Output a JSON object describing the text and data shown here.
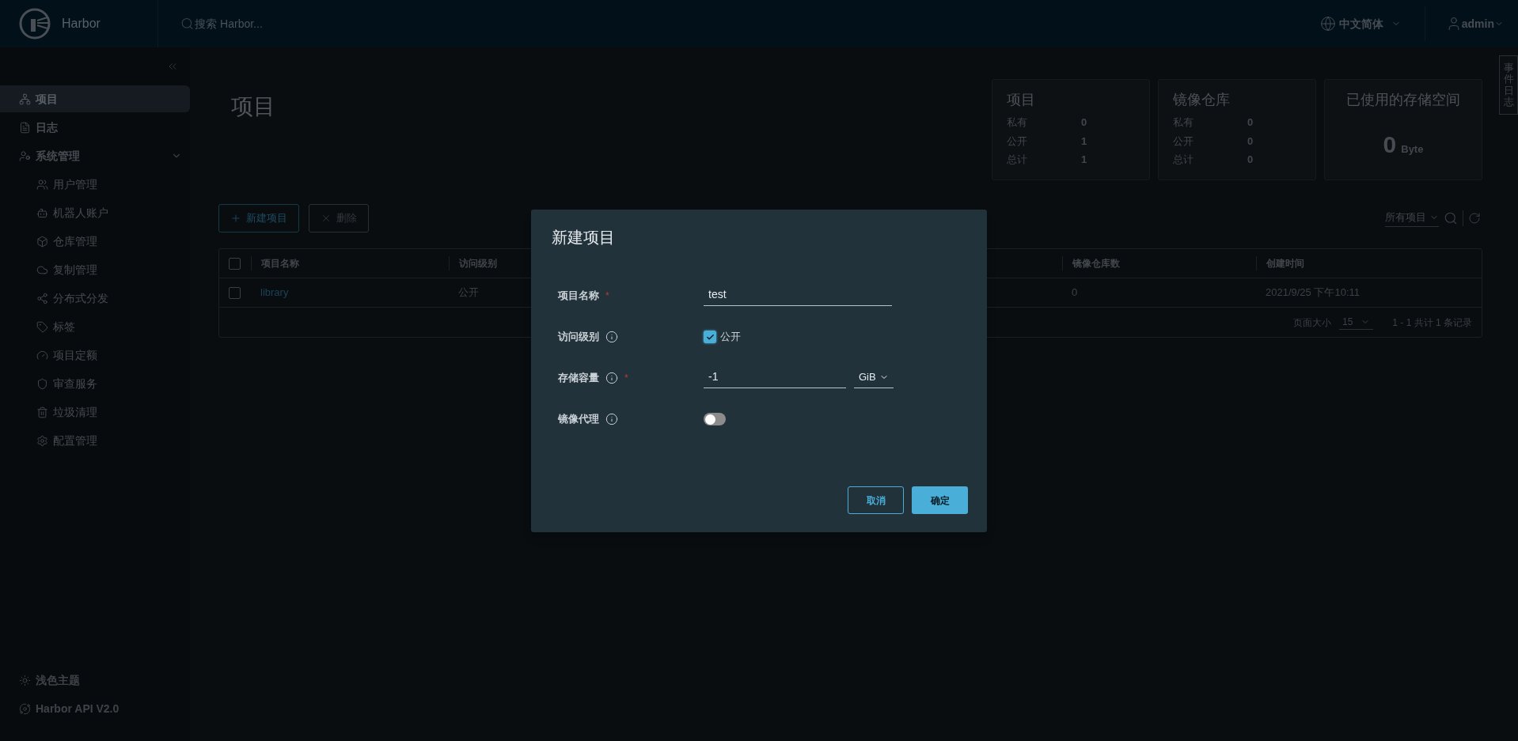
{
  "header": {
    "logo_text": "Harbor",
    "search_placeholder": "搜索 Harbor...",
    "language": "中文简体",
    "user": "admin"
  },
  "sidebar": {
    "items": [
      {
        "label": "项目",
        "selected": true
      },
      {
        "label": "日志",
        "selected": false
      },
      {
        "label": "系统管理",
        "selected": false,
        "expanded": true,
        "children": [
          {
            "label": "用户管理",
            "selected": false
          },
          {
            "label": "机器人账户",
            "selected": false
          },
          {
            "label": "仓库管理",
            "selected": false
          },
          {
            "label": "复制管理",
            "selected": false
          },
          {
            "label": "分布式分发",
            "selected": false
          },
          {
            "label": "标签",
            "selected": false
          },
          {
            "label": "项目定额",
            "selected": false
          },
          {
            "label": "审查服务",
            "selected": false
          },
          {
            "label": "垃圾清理",
            "selected": false
          },
          {
            "label": "配置管理",
            "selected": false
          }
        ]
      }
    ],
    "footer": [
      "浅色主题",
      "Harbor API V2.0"
    ]
  },
  "event_log_tab": "事件日志",
  "page_title": "项目",
  "stats": [
    {
      "kind": "counts",
      "title": "项目",
      "rows": [
        {
          "label": "私有",
          "value": "0"
        },
        {
          "label": "公开",
          "value": "1"
        },
        {
          "label": "总计",
          "value": "1"
        }
      ]
    },
    {
      "kind": "counts",
      "title": "镜像仓库",
      "rows": [
        {
          "label": "私有",
          "value": "0"
        },
        {
          "label": "公开",
          "value": "0"
        },
        {
          "label": "总计",
          "value": "0"
        }
      ]
    },
    {
      "kind": "storage",
      "title": "已使用的存储空间",
      "value": "0",
      "unit": "Byte"
    }
  ],
  "toolbar": {
    "buttons": [
      {
        "label": "新建项目",
        "disabled": false
      },
      {
        "label": "删除",
        "disabled": true
      }
    ],
    "filter": "所有项目"
  },
  "table": {
    "columns": [
      "项目名称",
      "访问级别",
      "镜像仓库数",
      "创建时间"
    ],
    "all_checked": false,
    "rows": [
      {
        "selected": false,
        "cells": [
          "library",
          "公开",
          "0",
          "2021/9/25 下午10:11"
        ]
      }
    ]
  },
  "pagination": {
    "page_size_label": "页面大小",
    "page_size": "15",
    "summary": "1 - 1 共计 1 条记录"
  },
  "dialog": {
    "title": "新建项目",
    "fields": [
      {
        "kind": "text",
        "label": "项目名称",
        "required_mark": "*",
        "info": false,
        "value": "test"
      },
      {
        "kind": "checkbox",
        "label": "访问级别",
        "info": true,
        "checked": true,
        "option": "公开"
      },
      {
        "kind": "quota",
        "label": "存储容量",
        "required_mark": "*",
        "info": true,
        "value": "-1",
        "unit": "GiB"
      },
      {
        "kind": "toggle",
        "label": "镜像代理",
        "info": true,
        "on": false
      }
    ],
    "buttons": [
      {
        "label": "取消",
        "primary": false
      },
      {
        "label": "确定",
        "primary": true
      }
    ]
  }
}
